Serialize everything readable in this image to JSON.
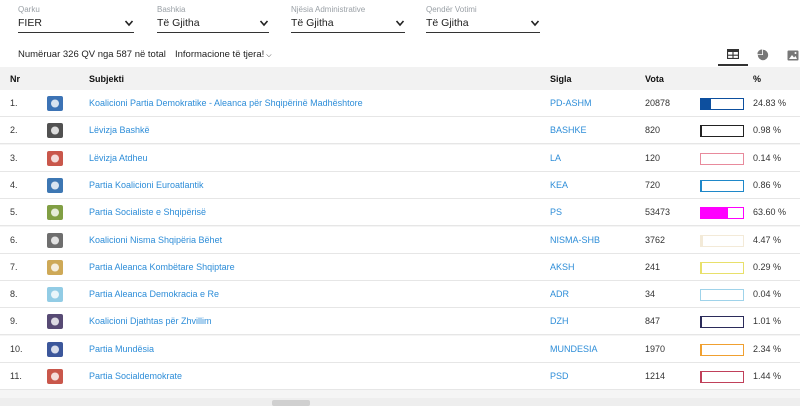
{
  "filters": [
    {
      "label": "Qarku",
      "value": "FIER"
    },
    {
      "label": "Bashkia",
      "value": "Të Gjitha"
    },
    {
      "label": "Njësia Administrative",
      "value": "Të Gjitha"
    },
    {
      "label": "Qendër Votimi",
      "value": "Të Gjitha"
    }
  ],
  "info": {
    "count_text": "Numëruar 326 QV nga 587 në total",
    "more_label": "Informacione të tjera!"
  },
  "views": [
    "table-icon",
    "pie-chart-icon",
    "image-icon"
  ],
  "table": {
    "headers": {
      "nr": "Nr",
      "subjekti": "Subjekti",
      "sigla": "Sigla",
      "vota": "Vota",
      "pct": "%"
    },
    "rows": [
      {
        "nr": "1.",
        "name": "Koalicioni Partia Demokratike - Aleanca për Shqipërinë Madhështore",
        "sigla": "PD-ASHM",
        "vota": "20878",
        "pct": "24.83 %",
        "share": 24.83,
        "color": "#0d4f9e",
        "logo_color": "#1a5aa8",
        "logo_icon": "pd-logo-icon"
      },
      {
        "nr": "2.",
        "name": "Lëvizja Bashkë",
        "sigla": "BASHKE",
        "vota": "820",
        "pct": "0.98 %",
        "share": 0.98,
        "color": "#222222",
        "logo_color": "#333333",
        "logo_icon": "bashke-logo-icon"
      },
      {
        "nr": "3.",
        "name": "Lëvizja Atdheu",
        "sigla": "LA",
        "vota": "120",
        "pct": "0.14 %",
        "share": 0.14,
        "color": "#e88a9c",
        "logo_color": "#c0392b",
        "logo_icon": "atdheu-logo-icon"
      },
      {
        "nr": "4.",
        "name": "Partia Koalicioni Euroatlantik",
        "sigla": "KEA",
        "vota": "720",
        "pct": "0.86 %",
        "share": 0.86,
        "color": "#1f88c9",
        "logo_color": "#1b5fa6",
        "logo_icon": "kea-logo-icon"
      },
      {
        "nr": "5.",
        "name": "Partia Socialiste e Shqipërisë",
        "sigla": "PS",
        "vota": "53473",
        "pct": "63.60 %",
        "share": 63.6,
        "color": "#ff00ff",
        "logo_color": "#6b8e23",
        "logo_icon": "ps-logo-icon"
      },
      {
        "nr": "6.",
        "name": "Koalicioni Nisma Shqipëria Bëhet",
        "sigla": "NISMA-SHB",
        "vota": "3762",
        "pct": "4.47 %",
        "share": 4.47,
        "color": "#f3ead8",
        "logo_color": "#555555",
        "logo_icon": "nisma-logo-icon"
      },
      {
        "nr": "7.",
        "name": "Partia Aleanca Kombëtare Shqiptare",
        "sigla": "AKSH",
        "vota": "241",
        "pct": "0.29 %",
        "share": 0.29,
        "color": "#e8e06a",
        "logo_color": "#c59a3a",
        "logo_icon": "aksh-logo-icon"
      },
      {
        "nr": "8.",
        "name": "Partia Aleanca Demokracia e Re",
        "sigla": "ADR",
        "vota": "34",
        "pct": "0.04 %",
        "share": 0.04,
        "color": "#9fd3ea",
        "logo_color": "#7fc3e0",
        "logo_icon": "adr-logo-icon"
      },
      {
        "nr": "9.",
        "name": "Koalicioni Djathtas për Zhvillim",
        "sigla": "DZH",
        "vota": "847",
        "pct": "1.01 %",
        "share": 1.01,
        "color": "#2b2b5a",
        "logo_color": "#3a2a5c",
        "logo_icon": "dzh-logo-icon"
      },
      {
        "nr": "10.",
        "name": "Partia Mundësia",
        "sigla": "MUNDESIA",
        "vota": "1970",
        "pct": "2.34 %",
        "share": 2.34,
        "color": "#f0a030",
        "logo_color": "#1a3a8a",
        "logo_icon": "mundesia-logo-icon"
      },
      {
        "nr": "11.",
        "name": "Partia Socialdemokrate",
        "sigla": "PSD",
        "vota": "1214",
        "pct": "1.44 %",
        "share": 1.44,
        "color": "#c0405a",
        "logo_color": "#c0392b",
        "logo_icon": "psd-logo-icon"
      }
    ]
  }
}
